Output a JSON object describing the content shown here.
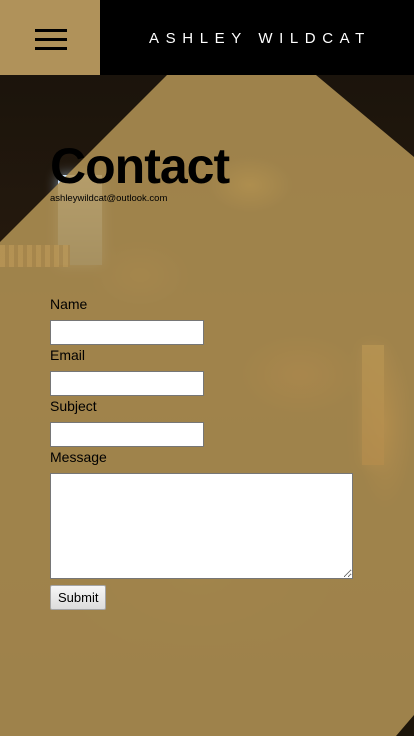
{
  "header": {
    "site_title": "ASHLEY WILDCAT",
    "menu_icon": "hamburger-menu-icon"
  },
  "contact": {
    "heading": "Contact",
    "email": "ashleywildcat@outlook.com"
  },
  "form": {
    "name_label": "Name",
    "name_value": "",
    "email_label": "Email",
    "email_value": "",
    "subject_label": "Subject",
    "subject_value": "",
    "message_label": "Message",
    "message_value": "",
    "submit_label": "Submit"
  },
  "colors": {
    "header_bg": "#000000",
    "accent_gold": "#b0925a",
    "title_text": "#ffffff"
  }
}
